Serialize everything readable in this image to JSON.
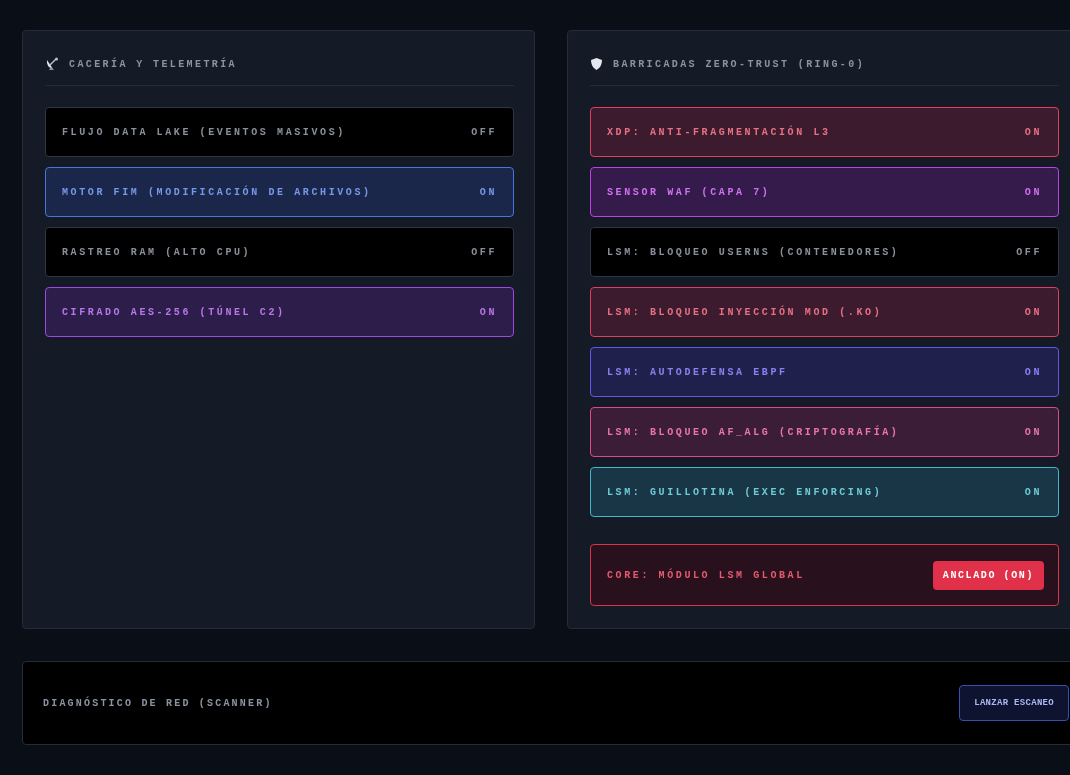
{
  "panels": [
    {
      "title": "CACERÍA Y TELEMETRÍA",
      "toggles": [
        {
          "label": "FLUJO DATA LAKE (EVENTOS MASIVOS)",
          "state": "OFF",
          "on": false,
          "color": "#2f3542"
        },
        {
          "label": "MOTOR FIM (MODIFICACIÓN DE ARCHIVOS)",
          "state": "ON",
          "on": true,
          "color": "#4a74e0"
        },
        {
          "label": "RASTREO RAM (ALTO CPU)",
          "state": "OFF",
          "on": false,
          "color": "#2f3542"
        },
        {
          "label": "CIFRADO AES-256 (TÚNEL C2)",
          "state": "ON",
          "on": true,
          "color": "#a048e0"
        }
      ]
    },
    {
      "title": "BARRICADAS ZERO-TRUST (RING-0)",
      "toggles": [
        {
          "label": "XDP: ANTI-FRAGMENTACIÓN L3",
          "state": "ON",
          "on": true,
          "color": "#e0405a"
        },
        {
          "label": "SENSOR WAF (CAPA 7)",
          "state": "ON",
          "on": true,
          "color": "#c040e8"
        },
        {
          "label": "LSM: BLOQUEO USERNS (CONTENEDORES)",
          "state": "OFF",
          "on": false,
          "color": "#2f3542"
        },
        {
          "label": "LSM: BLOQUEO INYECCIÓN MOD (.KO)",
          "state": "ON",
          "on": true,
          "color": "#e0405a"
        },
        {
          "label": "LSM: AUTODEFENSA EBPF",
          "state": "ON",
          "on": true,
          "color": "#6058e8"
        },
        {
          "label": "LSM: BLOQUEO AF_ALG (CRIPTOGRAFÍA)",
          "state": "ON",
          "on": true,
          "color": "#e04888"
        },
        {
          "label": "LSM: GUILLOTINA (EXEC ENFORCING)",
          "state": "ON",
          "on": true,
          "color": "#40b8c8"
        }
      ],
      "core": {
        "label": "CORE: MÓDULO LSM GLOBAL",
        "badge": "ANCLADO (ON)",
        "color": "#e0304a"
      }
    }
  ],
  "scanner": {
    "label": "DIAGNÓSTICO DE RED (SCANNER)",
    "button": "LANZAR ESCANEO"
  }
}
